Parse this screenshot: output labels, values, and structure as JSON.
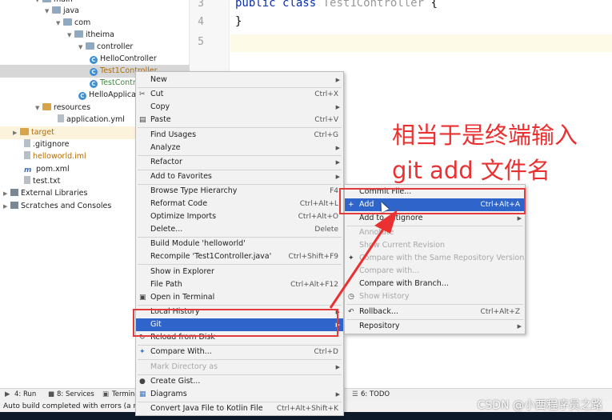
{
  "tree": {
    "main": "main",
    "java": "java",
    "com": "com",
    "itheima": "itheima",
    "controller": "controller",
    "hello_controller": "HelloController",
    "test1_controller": "Test1Controller",
    "test_controller": "TestContr",
    "hello_app": "HelloApplica",
    "resources": "resources",
    "application_yml": "application.yml",
    "target": "target",
    "gitignore": ".gitignore",
    "helloworld_iml": "helloworld.iml",
    "pom_xml": "pom.xml",
    "test_txt": "test.txt",
    "external_libraries": "External Libraries",
    "scratches": "Scratches and Consoles"
  },
  "editor": {
    "line3": "3",
    "line4": "4",
    "line5": "5",
    "code_kw1": "public",
    "code_kw2": "class",
    "code_class": "Test1Controller",
    "code_brace_open": "{",
    "code_brace_close": "}"
  },
  "context_menu": {
    "new": "New",
    "cut": "Cut",
    "cut_sc": "Ctrl+X",
    "copy": "Copy",
    "paste": "Paste",
    "paste_sc": "Ctrl+V",
    "find_usages": "Find Usages",
    "find_usages_sc": "Ctrl+G",
    "analyze": "Analyze",
    "refactor": "Refactor",
    "add_favorites": "Add to Favorites",
    "browse_hierarchy": "Browse Type Hierarchy",
    "browse_hierarchy_sc": "F4",
    "reformat": "Reformat Code",
    "reformat_sc": "Ctrl+Alt+L",
    "optimize_imports": "Optimize Imports",
    "optimize_imports_sc": "Ctrl+Alt+O",
    "delete": "Delete...",
    "delete_sc": "Delete",
    "build_module": "Build Module 'helloworld'",
    "recompile": "Recompile 'Test1Controller.java'",
    "recompile_sc": "Ctrl+Shift+F9",
    "show_explorer": "Show in Explorer",
    "file_path": "File Path",
    "file_path_sc": "Ctrl+Alt+F12",
    "open_terminal": "Open in Terminal",
    "local_history": "Local History",
    "git": "Git",
    "reload": "Reload from Disk",
    "compare_with": "Compare With...",
    "compare_with_sc": "Ctrl+D",
    "mark_directory": "Mark Directory as",
    "create_gist": "Create Gist...",
    "diagrams": "Diagrams",
    "convert_kotlin": "Convert Java File to Kotlin File",
    "convert_kotlin_sc": "Ctrl+Alt+Shift+K"
  },
  "git_menu": {
    "commit_file": "Commit File...",
    "add": "Add",
    "add_sc": "Ctrl+Alt+A",
    "add_gitignore": "Add to .gitignore",
    "annotate": "Annotate",
    "show_current_revision": "Show Current Revision",
    "compare_same_repo": "Compare with the Same Repository Version",
    "compare_with": "Compare with...",
    "compare_branch": "Compare with Branch...",
    "show_history": "Show History",
    "rollback": "Rollback...",
    "rollback_sc": "Ctrl+Alt+Z",
    "repository": "Repository"
  },
  "bottom": {
    "run": "4: Run",
    "services": "8: Services",
    "terminal": "Termina",
    "todo": "6: TODO",
    "status": "Auto build completed with errors (a m"
  },
  "annotation": {
    "line1": "相当于是终端输入",
    "line2": "git add 文件名"
  },
  "watermark": "CSDN @小西程序员之路",
  "colors": {
    "highlight": "#2f65ca",
    "annotation_red": "#ea3030"
  }
}
